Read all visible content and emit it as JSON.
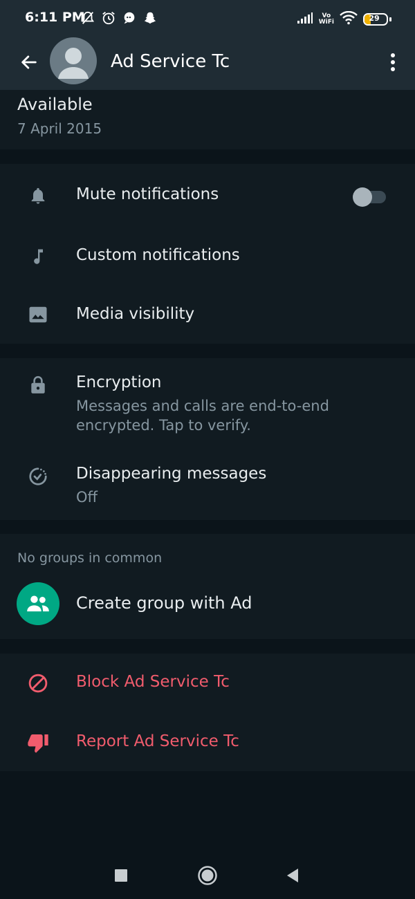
{
  "status_bar": {
    "time": "6:11 PM",
    "vo_label": "Vo",
    "wifi_label": "WiFi",
    "battery_level": "29",
    "battery_percent": 29,
    "icons": [
      "mute-bell-icon",
      "alarm-icon",
      "chat-bubble-icon",
      "snapchat-icon",
      "signal-icon",
      "wifi-icon",
      "battery-icon"
    ]
  },
  "header": {
    "contact_name": "Ad Service Tc",
    "icons": [
      "back-arrow-icon",
      "avatar-icon",
      "more-vert-icon"
    ]
  },
  "about": {
    "status": "Available",
    "date": "7 April 2015"
  },
  "notifications": {
    "mute_label": "Mute notifications",
    "mute_on": false,
    "custom_label": "Custom notifications",
    "media_label": "Media visibility"
  },
  "privacy": {
    "encryption_title": "Encryption",
    "encryption_sub": "Messages and calls are end-to-end encrypted. Tap to verify.",
    "disappearing_title": "Disappearing messages",
    "disappearing_sub": "Off"
  },
  "groups": {
    "section_label": "No groups in common",
    "create_label": "Create group with Ad"
  },
  "danger": {
    "block_label": "Block Ad Service Tc",
    "report_label": "Report Ad Service Tc"
  },
  "colors": {
    "background": "#0b141a",
    "card": "#111b21",
    "header": "#1f2c34",
    "accent": "#00a884",
    "danger": "#f15c6d",
    "secondary_text": "#8696a0"
  },
  "nav_icons": [
    "recent-apps-icon",
    "home-icon",
    "back-icon"
  ]
}
